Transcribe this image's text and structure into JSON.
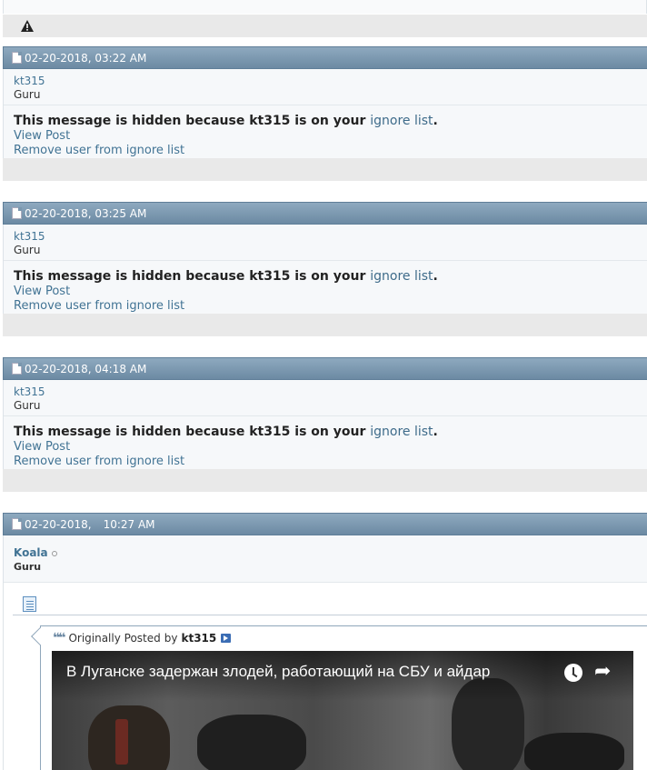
{
  "posts": [
    {
      "date": "02-20-2018, 03:22 AM",
      "username": "kt315",
      "usertitle": "Guru",
      "hidden_prefix": "This message is hidden because kt315 is on your ",
      "ignore_link": "ignore list",
      "hidden_suffix": ".",
      "view_post": "View Post",
      "remove_user": "Remove user from ignore list"
    },
    {
      "date": "02-20-2018, 03:25 AM",
      "username": "kt315",
      "usertitle": "Guru",
      "hidden_prefix": "This message is hidden because kt315 is on your ",
      "ignore_link": "ignore list",
      "hidden_suffix": ".",
      "view_post": "View Post",
      "remove_user": "Remove user from ignore list"
    },
    {
      "date": "02-20-2018, 04:18 AM",
      "username": "kt315",
      "usertitle": "Guru",
      "hidden_prefix": "This message is hidden because kt315 is on your ",
      "ignore_link": "ignore list",
      "hidden_suffix": ".",
      "view_post": "View Post",
      "remove_user": "Remove user from ignore list"
    }
  ],
  "koala_post": {
    "date": "02-20-2018,",
    "time": "10:27 AM",
    "username": "Koala",
    "usertitle": "Guru",
    "quote": {
      "originally_posted": "Originally Posted",
      "by": "by",
      "author": "kt315"
    },
    "video": {
      "title": "В Луганске задержан злодей, работающий на СБУ и айдар"
    }
  },
  "icons": {
    "warning": "warning-icon",
    "post": "document-icon",
    "quote": "quote-icon",
    "jump": "view-post-icon",
    "watch_later": "clock-icon",
    "share": "share-icon"
  }
}
